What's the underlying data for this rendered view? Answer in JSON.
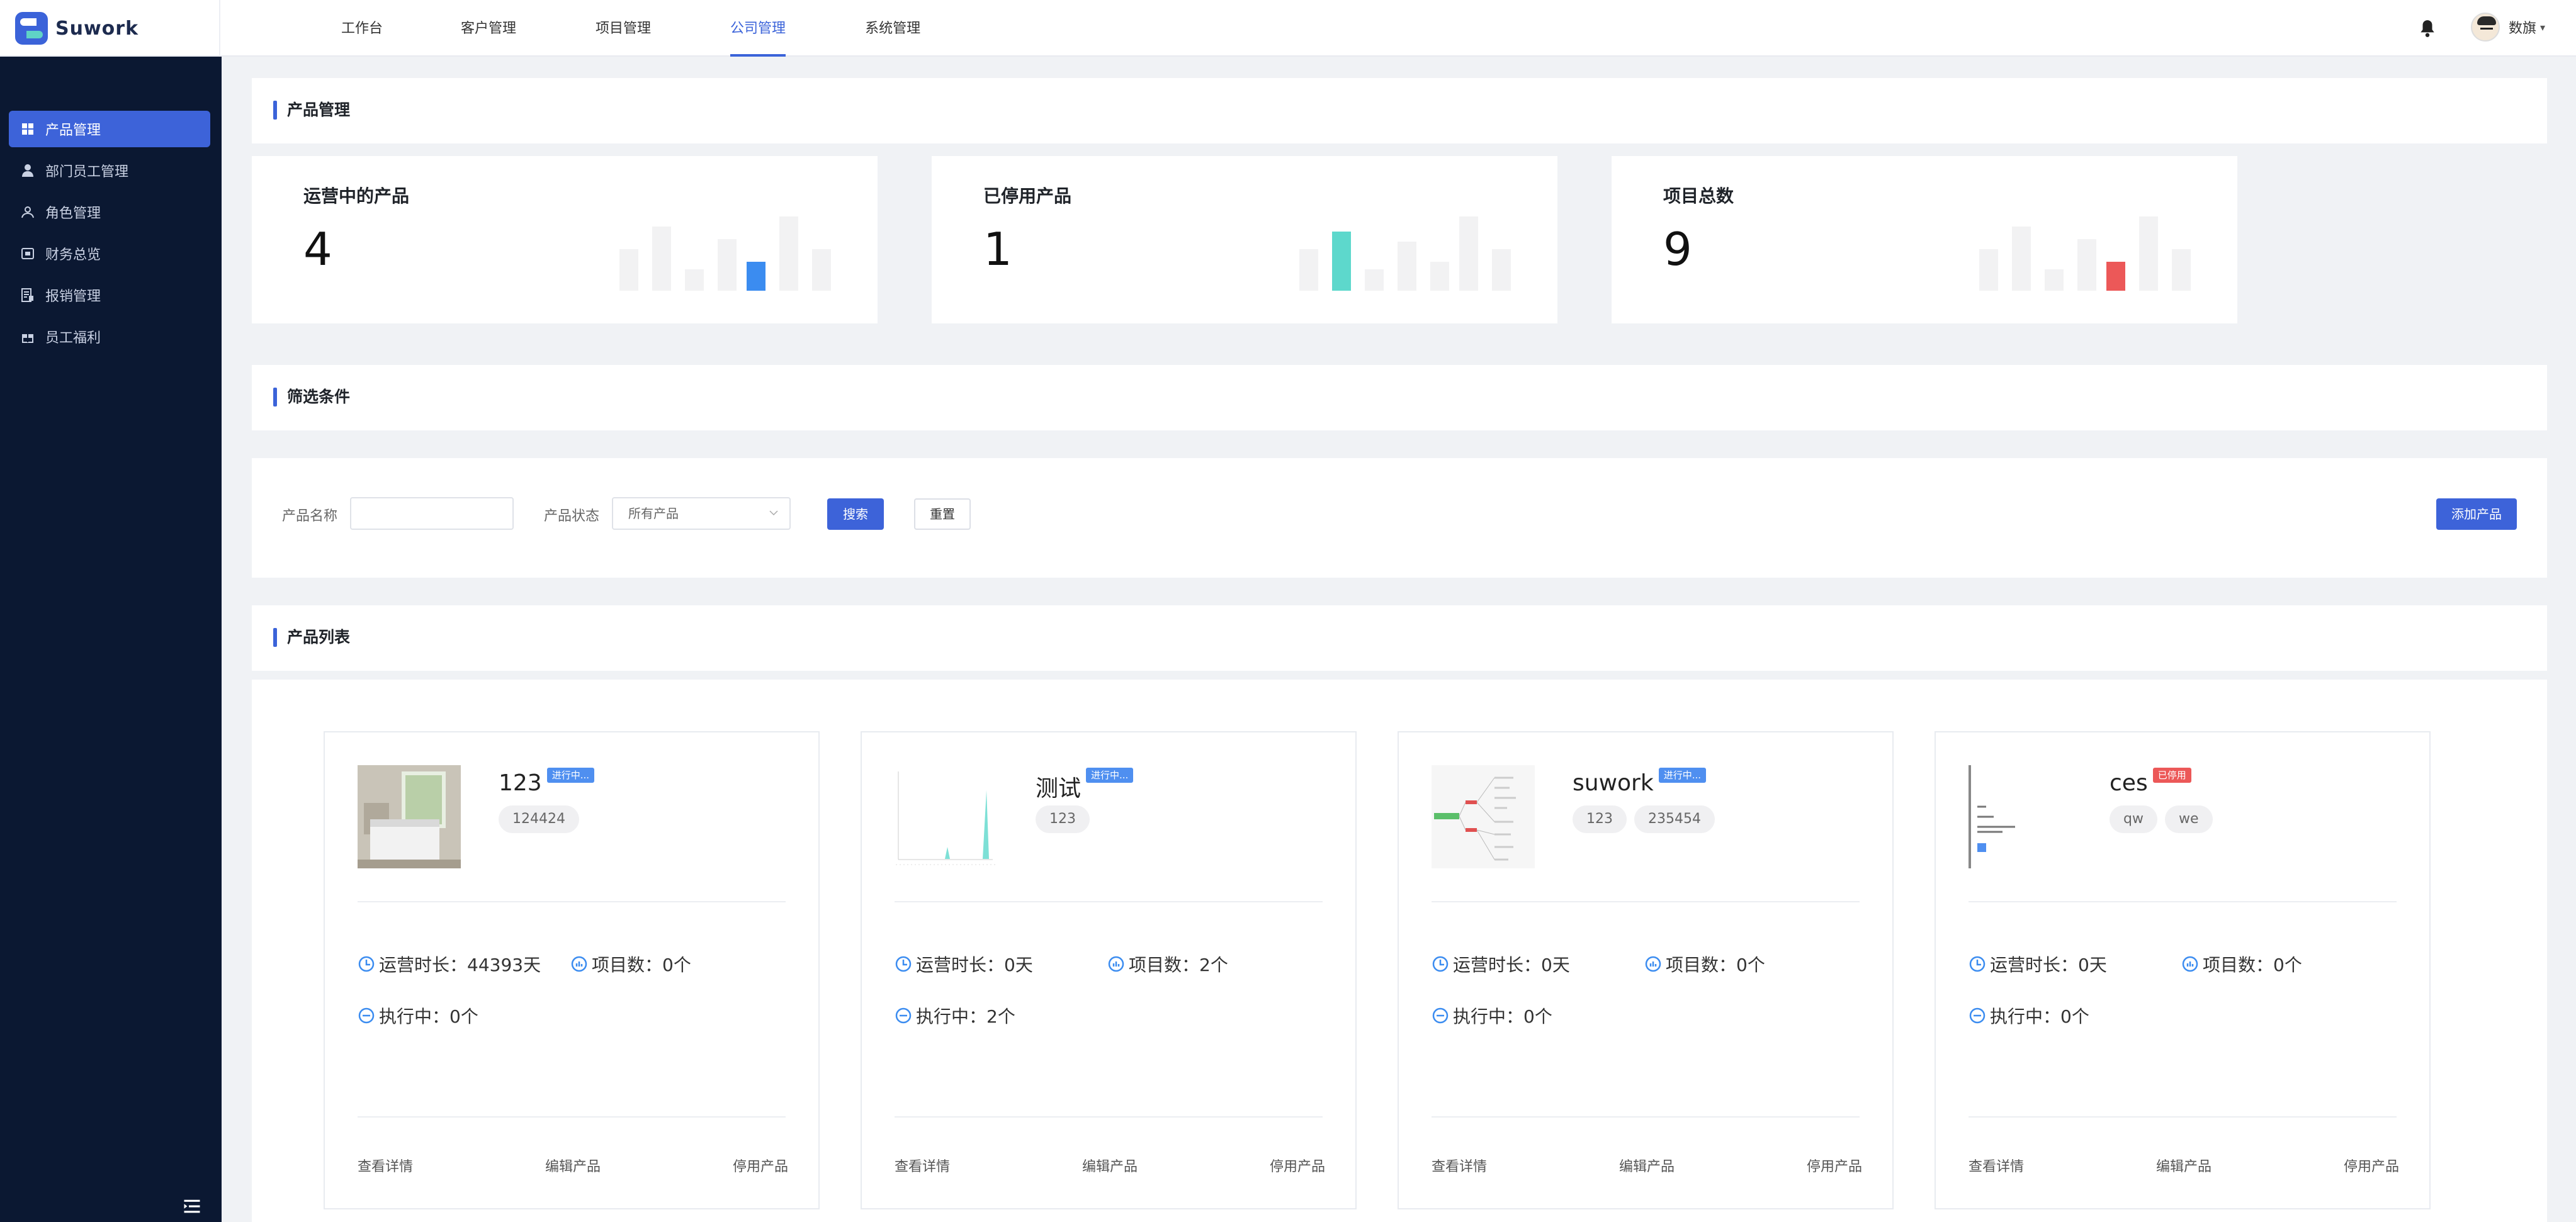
{
  "app": {
    "logo_text": "Suwork"
  },
  "top_nav": [
    {
      "label": "工作台"
    },
    {
      "label": "客户管理"
    },
    {
      "label": "项目管理"
    },
    {
      "label": "公司管理",
      "active": true
    },
    {
      "label": "系统管理"
    }
  ],
  "user": {
    "name": "数旗"
  },
  "sidebar": {
    "items": [
      {
        "label": "产品管理",
        "icon": "grid-icon",
        "active": true
      },
      {
        "label": "部门员工管理",
        "icon": "user-icon"
      },
      {
        "label": "角色管理",
        "icon": "role-icon"
      },
      {
        "label": "财务总览",
        "icon": "finance-icon"
      },
      {
        "label": "报销管理",
        "icon": "reimburse-icon"
      },
      {
        "label": "员工福利",
        "icon": "gift-icon"
      }
    ]
  },
  "sections": {
    "product_management": "产品管理",
    "filter": "筛选条件",
    "product_list": "产品列表"
  },
  "stats": [
    {
      "label": "运营中的产品",
      "value": "4",
      "accent": "#3b8cf0"
    },
    {
      "label": "已停用产品",
      "value": "1",
      "accent": "#5dd8cc"
    },
    {
      "label": "项目总数",
      "value": "9",
      "accent": "#ec5858"
    }
  ],
  "filter": {
    "name_label": "产品名称",
    "name_value": "",
    "status_label": "产品状态",
    "status_value": "所有产品",
    "search_button": "搜索",
    "reset_button": "重置",
    "add_button": "添加产品"
  },
  "products": [
    {
      "name": "123",
      "status": "进行中...",
      "status_color": "blue",
      "tags": [
        "124424"
      ],
      "metrics": {
        "duration": "运营时长：44393天",
        "projects": "项目数：0个",
        "running": "执行中：0个"
      },
      "thumb": "bedroom-photo"
    },
    {
      "name": "测试",
      "status": "进行中...",
      "status_color": "blue",
      "tags": [
        "123"
      ],
      "metrics": {
        "duration": "运营时长：0天",
        "projects": "项目数：2个",
        "running": "执行中：2个"
      },
      "thumb": "chart-screenshot"
    },
    {
      "name": "suwork",
      "status": "进行中...",
      "status_color": "blue",
      "tags": [
        "123",
        "235454"
      ],
      "metrics": {
        "duration": "运营时长：0天",
        "projects": "项目数：0个",
        "running": "执行中：0个"
      },
      "thumb": "mindmap-screenshot"
    },
    {
      "name": "ces",
      "status": "已停用",
      "status_color": "red",
      "tags": [
        "qw",
        "we"
      ],
      "metrics": {
        "duration": "运营时长：0天",
        "projects": "项目数：0个",
        "running": "执行中：0个"
      },
      "thumb": "document-screenshot"
    }
  ],
  "card_actions": {
    "view": "查看详情",
    "edit": "编辑产品",
    "disable": "停用产品"
  },
  "colors": {
    "primary": "#3d63d9",
    "sidebar_bg": "#0b1832",
    "page_bg": "#f0f2f5"
  }
}
